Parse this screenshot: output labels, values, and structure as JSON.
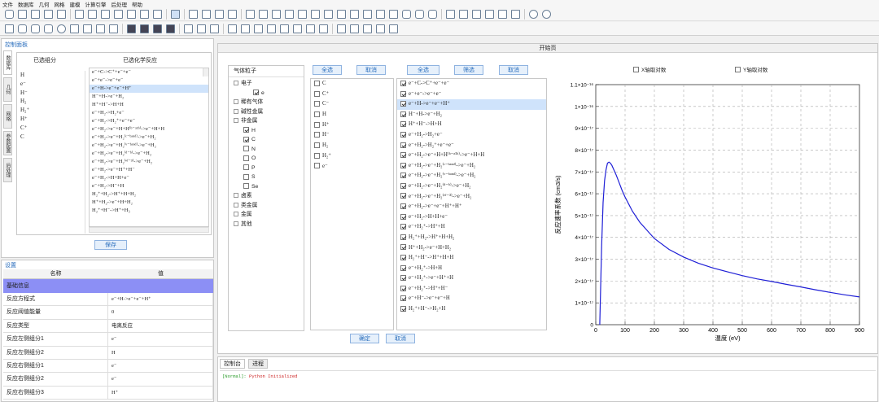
{
  "menu": [
    "文件",
    "数据库",
    "几何",
    "网格",
    "建模",
    "计算引擎",
    "后处理",
    "帮助"
  ],
  "left_panel": {
    "title": "控制面板",
    "vtabs": [
      "数据库",
      "几何",
      "网格",
      "参数配置",
      "后处理"
    ],
    "col_selected": "已选组分",
    "col_reactions": "已选化学反应",
    "components": [
      "H",
      "e⁻",
      "H⁻",
      "H₂",
      "H₂⁺",
      "H⁺",
      "C⁺",
      "C"
    ],
    "reactions": [
      "e⁻+C->C⁺+e⁻+e⁻",
      "e⁻+e⁻->e⁻+e⁻",
      "e⁻+H->e⁻+e⁻+H⁺",
      "H⁻+H->e⁻+H₂",
      "H⁺+H⁻->H+H",
      "e⁻+H₂->H₂+e⁻",
      "e⁻+H₂->H₂⁺+e⁻+e⁻",
      "e⁻+H₂->e⁻+H+H⁽ᵇ⁻ᵃ¹ᵇ⁾->e⁻+H+H",
      "e⁻+H₂->e⁻+H₂⁽ᶜ⁻ᵇᵃⁿᵈ⁾->e⁻+H₂",
      "e⁻+H₂->e⁻+H₂⁽ᵛ⁻ᵇᵃⁿᵈ⁾->e⁻+H₂",
      "e⁻+H₂->e⁻+H₂⁽ᵈ⁻ᵇ⁾->e⁻+H₂",
      "e⁻+H₂->e⁻+H₂⁽ᵉᶠ⁻³⁾->e⁻+H₂",
      "e⁻+H₂->e⁻+H⁺+H⁻",
      "e⁻+H₂->H+H+e⁻",
      "e⁻+H₂->H⁻+H",
      "H₂⁺+H₂->H⁺+H+H₂",
      "H⁺+H₂->e⁻+H+H₂",
      "H₂⁺+H⁻->H⁺+H₃"
    ],
    "save": "保存"
  },
  "settings": {
    "title": "设置",
    "col_name": "名称",
    "col_value": "值",
    "section": "基础信息",
    "rows": [
      {
        "k": "反应方程式",
        "v": "e⁻+H->e⁻+e⁻+H⁺"
      },
      {
        "k": "反应阈值能量",
        "v": "0"
      },
      {
        "k": "反应类型",
        "v": "电离反应"
      },
      {
        "k": "反应左侧组分1",
        "v": "e⁻"
      },
      {
        "k": "反应左侧组分2",
        "v": "H"
      },
      {
        "k": "反应右侧组分1",
        "v": "e⁻"
      },
      {
        "k": "反应右侧组分2",
        "v": "e⁻"
      },
      {
        "k": "反应右侧组分3",
        "v": "H⁺"
      }
    ]
  },
  "main": {
    "header": "开始页",
    "gas_title": "气体粒子",
    "tree": [
      {
        "label": "电子",
        "level": 0,
        "type": "exp"
      },
      {
        "label": "e",
        "level": 2,
        "type": "cb",
        "checked": true
      },
      {
        "label": "稀有气体",
        "level": 0,
        "type": "exp"
      },
      {
        "label": "碱性金属",
        "level": 0,
        "type": "exp"
      },
      {
        "label": "非金属",
        "level": 0,
        "type": "exp"
      },
      {
        "label": "H",
        "level": 1,
        "type": "cb",
        "checked": true
      },
      {
        "label": "C",
        "level": 1,
        "type": "cb",
        "checked": true
      },
      {
        "label": "N",
        "level": 1,
        "type": "cb",
        "checked": false
      },
      {
        "label": "O",
        "level": 1,
        "type": "cb",
        "checked": false
      },
      {
        "label": "P",
        "level": 1,
        "type": "cb",
        "checked": false
      },
      {
        "label": "S",
        "level": 1,
        "type": "cb",
        "checked": false
      },
      {
        "label": "Se",
        "level": 1,
        "type": "cb",
        "checked": false
      },
      {
        "label": "卤素",
        "level": 0,
        "type": "exp"
      },
      {
        "label": "类金属",
        "level": 0,
        "type": "exp"
      },
      {
        "label": "金属",
        "level": 0,
        "type": "exp"
      },
      {
        "label": "其他",
        "level": 0,
        "type": "exp"
      }
    ],
    "btn_all1": "全选",
    "btn_cancel1": "取消",
    "btn_all2": "全选",
    "btn_filter": "筛选",
    "btn_cancel2": "取消",
    "species": [
      "C",
      "C⁺",
      "C⁻",
      "H",
      "H⁺",
      "H⁻",
      "H₂",
      "H₂⁺",
      "e⁻"
    ],
    "reactions": [
      "e⁻+C->C⁺+e⁻+e⁻",
      "e⁻+e⁻->e⁻+e⁻",
      "e⁻+H->e⁻+e⁻+H⁺",
      "H⁻+H->e⁻+H₂",
      "H⁺+H⁻->H+H",
      "e⁻+H₂->H₂+e⁻",
      "e⁻+H₂->H₂⁺+e⁻+e⁻",
      "e⁻+H₂->e⁻+H+H⁽ᵇ⁻ᵃ¹ᵇ⁾->e⁻+H+H",
      "e⁻+H₂->e⁻+H₂⁽ᶜ⁻ᵇᵃⁿᵈ⁾->e⁻+H₂",
      "e⁻+H₂->e⁻+H₂⁽ᵛ⁻ᵇᵃⁿᵈ⁾->e⁻+H₂",
      "e⁻+H₂->e⁻+H₂⁽ᵈ⁻ᵇ⁾->e⁻+H₂",
      "e⁻+H₂->e⁻+H₂⁽ᵉᶠ⁻³⁾->e⁻+H₂",
      "e⁻+H₂->e⁻+e⁻+H⁺+H⁺",
      "e⁻+H₂->H+H+e⁻",
      "e⁻+H₂⁺->H⁺+H",
      "H₂⁺+H₂->H⁺+H+H₂",
      "H⁺+H₂->e⁻+H+H₂",
      "H₂⁺+H⁻->H⁺+H+H",
      "e⁻+H₂⁺->H+H",
      "e⁻+H₂⁺->e⁻+H⁺+H",
      "e⁻+H₂⁺->H⁺+H⁻",
      "e⁻+H⁻->e⁻+e⁻+H",
      "H₂⁺+H⁻->H₂+H"
    ],
    "btn_ok": "确定",
    "btn_cancel3": "取消",
    "xlog": "X轴取对数",
    "ylog": "Y轴取对数"
  },
  "chart_data": {
    "type": "line",
    "xlabel": "温度 (eV)",
    "ylabel": "反应速率系数 (cm3/s)",
    "xlim": [
      0,
      900
    ],
    "ylim": [
      0,
      1.1e-16
    ],
    "xticks": [
      0,
      100,
      200,
      300,
      400,
      500,
      600,
      700,
      800,
      900
    ],
    "ytick_labels": [
      "0",
      "1×10⁻¹⁷",
      "2×10⁻¹⁷",
      "3×10⁻¹⁷",
      "4×10⁻¹⁷",
      "5×10⁻¹⁷",
      "6×10⁻¹⁷",
      "7×10⁻¹⁷",
      "8×10⁻¹⁷",
      "9×10⁻¹⁷",
      "1×10⁻¹⁶",
      "1.1×10⁻¹⁶"
    ],
    "grid": true,
    "color": "#1f1fd6",
    "x": [
      13.6,
      20,
      25,
      30,
      35,
      40,
      45,
      50,
      55,
      60,
      70,
      80,
      90,
      100,
      125,
      150,
      200,
      250,
      300,
      350,
      400,
      450,
      500,
      550,
      600,
      650,
      700,
      750,
      800,
      850,
      900
    ],
    "y": [
      0,
      3.6e-17,
      5.6e-17,
      6.6e-17,
      7.1e-17,
      7.4e-17,
      7.45e-17,
      7.4e-17,
      7.3e-17,
      7.15e-17,
      6.85e-17,
      6.5e-17,
      6.15e-17,
      5.85e-17,
      5.2e-17,
      4.7e-17,
      3.95e-17,
      3.45e-17,
      3.1e-17,
      2.82e-17,
      2.6e-17,
      2.42e-17,
      2.25e-17,
      2.1e-17,
      1.98e-17,
      1.85e-17,
      1.73e-17,
      1.6e-17,
      1.48e-17,
      1.37e-17,
      1.27e-17
    ]
  },
  "console": {
    "tab1": "控制台",
    "tab2": "进程",
    "line_tag": "[Normal]:",
    "line_text": "Python Initialized"
  }
}
